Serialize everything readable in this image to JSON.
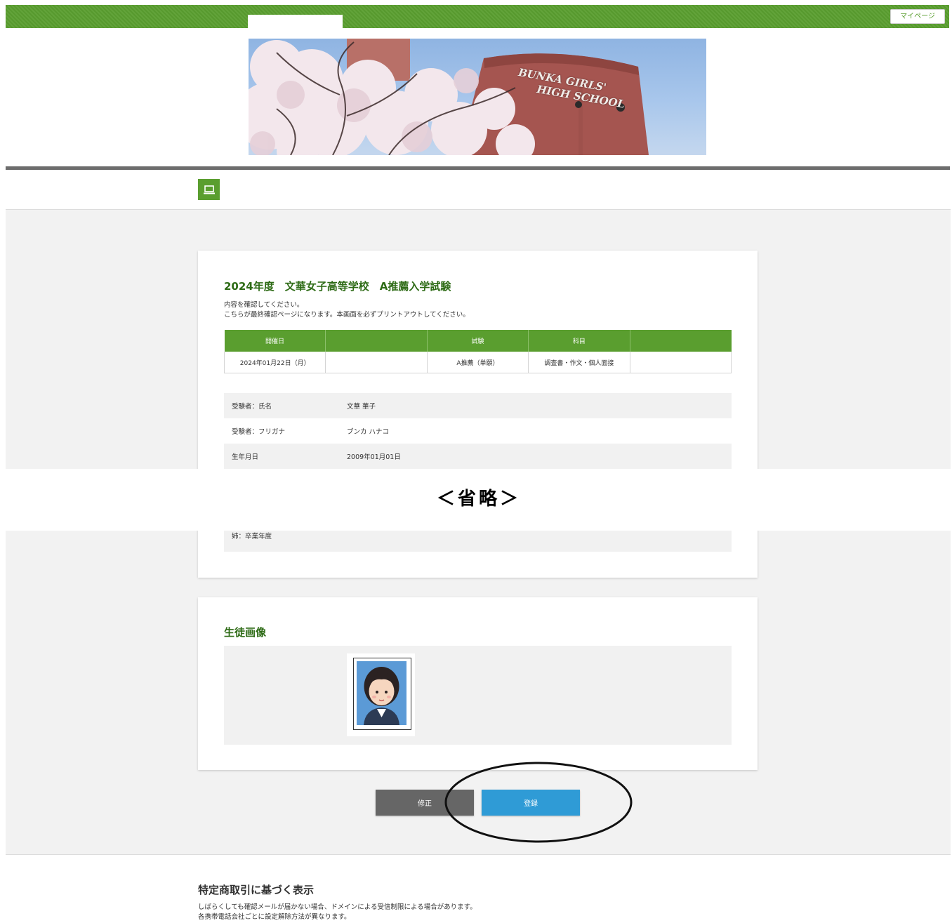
{
  "header": {
    "mypage_label": "マイページ"
  },
  "banner": {
    "sign_line1": "BUNKA GIRLS'",
    "sign_line2": "HIGH SCHOOL"
  },
  "exam": {
    "title": "2024年度　文華女子高等学校　A推薦入学試験",
    "intro_line1": "内容を確認してください。",
    "intro_line2": "こちらが最終確認ページになります。本画面を必ずプリントアウトしてください。",
    "columns": [
      "開催日",
      "",
      "試験",
      "科目",
      ""
    ],
    "row": [
      "2024年01月22日（月）",
      "",
      "A推薦（単願）",
      "調査書・作文・個人面接",
      ""
    ]
  },
  "applicant": {
    "rows": [
      {
        "label": "受験者：氏名",
        "value": "文華 華子"
      },
      {
        "label": "受験者：フリガナ",
        "value": "ブンカ ハナコ"
      },
      {
        "label": "生年月日",
        "value": "2009年01月01日"
      }
    ],
    "last_label": "姉：卒業年度"
  },
  "omission": {
    "label": "＜省略＞"
  },
  "photo_section": {
    "title": "生徒画像"
  },
  "buttons": {
    "fix_label": "修正",
    "register_label": "登録"
  },
  "footer": {
    "title": "特定商取引に基づく表示",
    "line1": "しばらくしても確認メールが届かない場合、ドメインによる受信制限による場合があります。",
    "line2": "各携帯電話会社ごとに設定解除方法が異なります。"
  },
  "colors": {
    "brand_green": "#5a9e2f",
    "heading_green": "#2e6b16",
    "register_blue": "#2f9bd6",
    "fix_gray": "#666666"
  }
}
